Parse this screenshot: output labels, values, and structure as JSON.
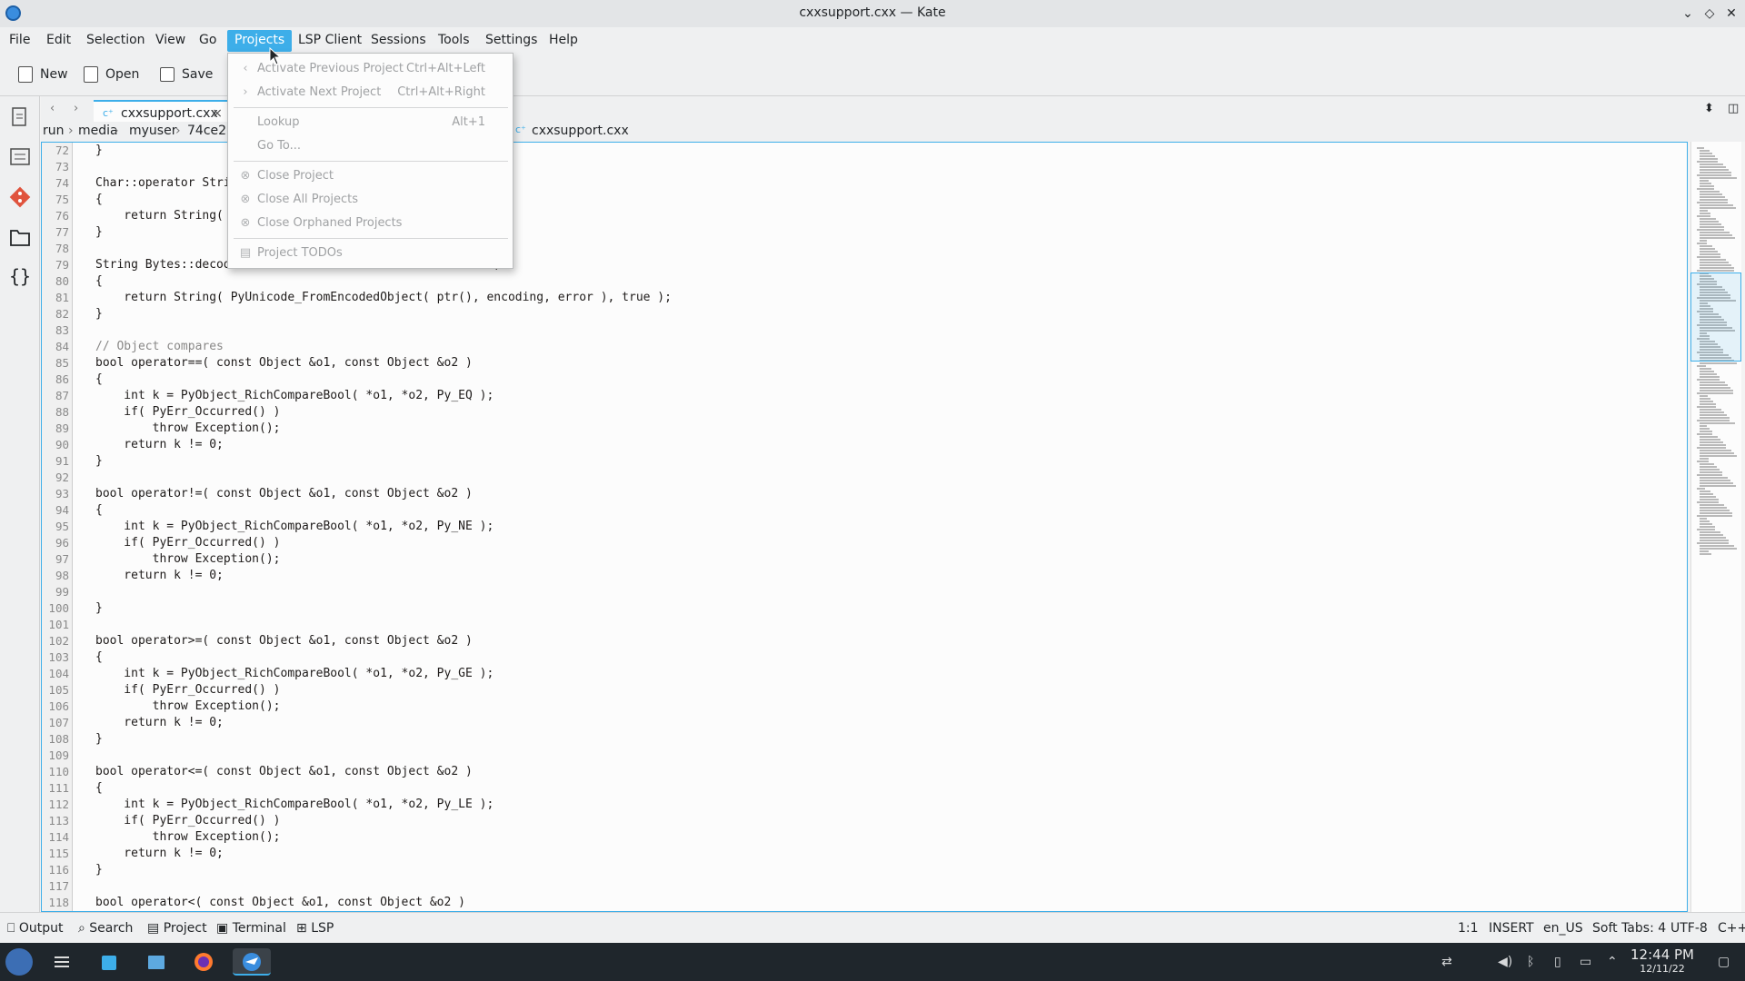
{
  "window": {
    "title": "cxxsupport.cxx — Kate"
  },
  "menubar": {
    "items": [
      "File",
      "Edit",
      "Selection",
      "View",
      "Go",
      "Projects",
      "LSP Client",
      "Sessions",
      "Tools",
      "Settings",
      "Help"
    ],
    "active": "Projects"
  },
  "toolbar": {
    "new_label": "New",
    "open_label": "Open",
    "save_label": "Save"
  },
  "tabs": [
    {
      "label": "cxxsupport.cxx"
    }
  ],
  "breadcrumb": [
    "run",
    "media",
    "myuser",
    "74ce2b",
    "cxxsupport.cxx"
  ],
  "projects_menu": {
    "items": [
      {
        "label": "Activate Previous Project",
        "shortcut": "Ctrl+Alt+Left",
        "icon": "chevron-left-icon"
      },
      {
        "label": "Activate Next Project",
        "shortcut": "Ctrl+Alt+Right",
        "icon": "chevron-right-icon"
      },
      {
        "label": "Lookup",
        "shortcut": "Alt+1",
        "icon": ""
      },
      {
        "label": "Go To...",
        "shortcut": "",
        "icon": ""
      },
      {
        "label": "Close Project",
        "shortcut": "",
        "icon": "close-circle-icon"
      },
      {
        "label": "Close All Projects",
        "shortcut": "",
        "icon": "close-circle-icon"
      },
      {
        "label": "Close Orphaned Projects",
        "shortcut": "",
        "icon": "close-circle-icon"
      },
      {
        "label": "Project TODOs",
        "shortcut": "",
        "icon": "list-icon"
      }
    ]
  },
  "code_lines": [
    {
      "n": "72",
      "t": "}"
    },
    {
      "n": "73",
      "t": ""
    },
    {
      "n": "74",
      "t": "Char::operator Stri"
    },
    {
      "n": "75",
      "t": "{"
    },
    {
      "n": "76",
      "t": "    return String("
    },
    {
      "n": "77",
      "t": "}"
    },
    {
      "n": "78",
      "t": ""
    },
    {
      "n": "79",
      "t": "String Bytes::decod                                  or )"
    },
    {
      "n": "80",
      "t": "{"
    },
    {
      "n": "81",
      "t": "    return String( PyUnicode_FromEncodedObject( ptr(), encoding, error ), true );"
    },
    {
      "n": "82",
      "t": "}"
    },
    {
      "n": "83",
      "t": ""
    },
    {
      "n": "84",
      "t": "// Object compares"
    },
    {
      "n": "85",
      "t": "bool operator==( const Object &o1, const Object &o2 )"
    },
    {
      "n": "86",
      "t": "{"
    },
    {
      "n": "87",
      "t": "    int k = PyObject_RichCompareBool( *o1, *o2, Py_EQ );"
    },
    {
      "n": "88",
      "t": "    if( PyErr_Occurred() )"
    },
    {
      "n": "89",
      "t": "        throw Exception();"
    },
    {
      "n": "90",
      "t": "    return k != 0;"
    },
    {
      "n": "91",
      "t": "}"
    },
    {
      "n": "92",
      "t": ""
    },
    {
      "n": "93",
      "t": "bool operator!=( const Object &o1, const Object &o2 )"
    },
    {
      "n": "94",
      "t": "{"
    },
    {
      "n": "95",
      "t": "    int k = PyObject_RichCompareBool( *o1, *o2, Py_NE );"
    },
    {
      "n": "96",
      "t": "    if( PyErr_Occurred() )"
    },
    {
      "n": "97",
      "t": "        throw Exception();"
    },
    {
      "n": "98",
      "t": "    return k != 0;"
    },
    {
      "n": "99",
      "t": ""
    },
    {
      "n": "100",
      "t": "}"
    },
    {
      "n": "101",
      "t": ""
    },
    {
      "n": "102",
      "t": "bool operator>=( const Object &o1, const Object &o2 )"
    },
    {
      "n": "103",
      "t": "{"
    },
    {
      "n": "104",
      "t": "    int k = PyObject_RichCompareBool( *o1, *o2, Py_GE );"
    },
    {
      "n": "105",
      "t": "    if( PyErr_Occurred() )"
    },
    {
      "n": "106",
      "t": "        throw Exception();"
    },
    {
      "n": "107",
      "t": "    return k != 0;"
    },
    {
      "n": "108",
      "t": "}"
    },
    {
      "n": "109",
      "t": ""
    },
    {
      "n": "110",
      "t": "bool operator<=( const Object &o1, const Object &o2 )"
    },
    {
      "n": "111",
      "t": "{"
    },
    {
      "n": "112",
      "t": "    int k = PyObject_RichCompareBool( *o1, *o2, Py_LE );"
    },
    {
      "n": "113",
      "t": "    if( PyErr_Occurred() )"
    },
    {
      "n": "114",
      "t": "        throw Exception();"
    },
    {
      "n": "115",
      "t": "    return k != 0;"
    },
    {
      "n": "116",
      "t": "}"
    },
    {
      "n": "117",
      "t": ""
    },
    {
      "n": "118",
      "t": "bool operator<( const Object &o1, const Object &o2 )"
    }
  ],
  "statusbar": {
    "left": [
      "Output",
      "Search",
      "Project",
      "Terminal",
      "LSP"
    ],
    "position": "1:1",
    "mode": "INSERT",
    "lang": "en_US",
    "tabs": "Soft Tabs: 4",
    "encoding": "UTF-8",
    "syntax": "C++"
  },
  "taskbar": {
    "time": "12:44 PM",
    "date": "12/11/22"
  },
  "colors": {
    "accent": "#3daee9",
    "keyword": "#1f1c1b",
    "string": "#bf0303"
  }
}
